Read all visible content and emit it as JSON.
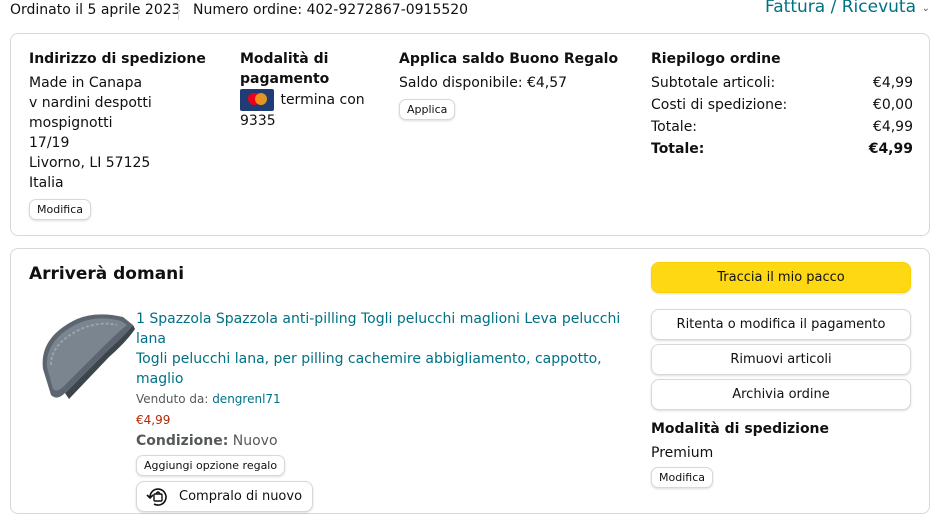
{
  "header": {
    "order_date": "Ordinato il 5 aprile 2023",
    "order_number": "Numero ordine: 402-9272867-0915520",
    "invoice_link": "Fattura / Ricevuta",
    "invoice_caret": "⌄"
  },
  "shipping": {
    "title": "Indirizzo di spedizione",
    "lines": [
      "Made in Canapa",
      "v nardini despotti mospignotti",
      "17/19",
      "Livorno, LI 57125",
      "Italia"
    ],
    "edit_label": "Modifica"
  },
  "payment": {
    "title_line1": "Modalità di",
    "title_line2": "pagamento",
    "card_icon": "mastercard-icon",
    "card_text_1": "termina con",
    "card_text_2": "9335"
  },
  "gift_card": {
    "title": "Applica saldo Buono Regalo",
    "balance": "Saldo disponibile: €4,57",
    "apply_label": "Applica"
  },
  "summary": {
    "title": "Riepilogo ordine",
    "rows": [
      {
        "label": "Subtotale articoli:",
        "value": "€4,99"
      },
      {
        "label": "Costi di spedizione:",
        "value": "€0,00"
      },
      {
        "label": "Totale:",
        "value": "€4,99"
      },
      {
        "label": "Totale:",
        "value": "€4,99"
      }
    ]
  },
  "delivery": {
    "title": "Arriverà domani",
    "product": {
      "title_line1": "1 Spazzola Spazzola anti-pilling Togli pelucchi maglioni Leva pelucchi lana",
      "title_line2": "Togli pelucchi lana, per pilling cachemire abbigliamento, cappotto, maglio",
      "sold_by_label": "Venduto da: ",
      "seller": "dengrenl71",
      "price": "€4,99",
      "condition_label": "Condizione:",
      "condition_value": " Nuovo",
      "gift_option": "Aggiungi opzione regalo",
      "buy_again": "Compralo di nuovo"
    },
    "actions": {
      "track": "Traccia il mio pacco",
      "retry_payment": "Ritenta o modifica il pagamento",
      "remove_items": "Rimuovi articoli",
      "archive": "Archivia ordine"
    },
    "shipping_mode": {
      "title": "Modalità di spedizione",
      "value": "Premium",
      "edit_label": "Modifica"
    }
  },
  "colors": {
    "link": "#007185",
    "price": "#b12704",
    "primary_button": "#ffd814",
    "border": "#d5d9d9"
  }
}
